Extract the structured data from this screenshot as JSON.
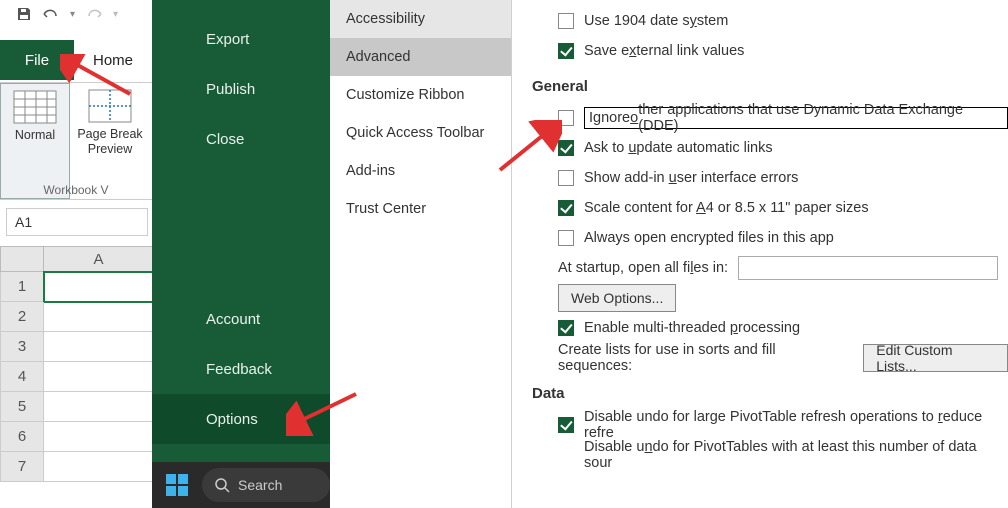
{
  "qat": {
    "save": "save-icon",
    "undo": "undo-icon",
    "redo": "redo-icon"
  },
  "tabs": {
    "file": "File",
    "home": "Home"
  },
  "ribbon": {
    "normal": "Normal",
    "pagebreak_line1": "Page Break",
    "pagebreak_line2": "Preview",
    "group_label": "Workbook V"
  },
  "namebox": "A1",
  "sheet": {
    "col": "A",
    "rows": [
      "1",
      "2",
      "3",
      "4",
      "5",
      "6",
      "7"
    ]
  },
  "backstage": {
    "items_top": [
      "Export",
      "Publish",
      "Close"
    ],
    "items_bottom": [
      "Account",
      "Feedback",
      "Options"
    ]
  },
  "taskbar": {
    "search": "Search"
  },
  "opt_categories": [
    {
      "label": "Accessibility",
      "state": "hover"
    },
    {
      "label": "Advanced",
      "state": "selected"
    },
    {
      "label": "Customize Ribbon",
      "state": ""
    },
    {
      "label": "Quick Access Toolbar",
      "state": ""
    },
    {
      "label": "Add-ins",
      "state": ""
    },
    {
      "label": "Trust Center",
      "state": ""
    }
  ],
  "advanced": {
    "use_1904": {
      "checked": false,
      "label_pre": "Use 1904 date s",
      "label_u": "y",
      "label_post": "stem"
    },
    "save_ext": {
      "checked": true,
      "label_pre": "Save e",
      "label_u": "x",
      "label_post": "ternal link values"
    },
    "section_general": "General",
    "ignore_dde": {
      "checked": false,
      "label_pre": "Ignore ",
      "label_u": "o",
      "label_post": "ther applications that use Dynamic Data Exchange (DDE)"
    },
    "ask_update": {
      "checked": true,
      "label_pre": "Ask to ",
      "label_u": "u",
      "label_post": "pdate automatic links"
    },
    "show_addin": {
      "checked": false,
      "label_pre": "Show add-in ",
      "label_u": "u",
      "label_post": "ser interface errors"
    },
    "scale_a4": {
      "checked": true,
      "label_pre": "Scale content for ",
      "label_u": "A",
      "label_post": "4 or 8.5 x 11\" paper sizes"
    },
    "always_open_enc": {
      "checked": false,
      "label": "Always open encrypted files in this app"
    },
    "startup_label_pre": "At startup, open all fi",
    "startup_label_u": "l",
    "startup_label_post": "es in:",
    "web_options": "Web Options...",
    "enable_multi": {
      "checked": true,
      "label_pre": "Enable multi-threaded ",
      "label_u": "p",
      "label_post": "rocessing"
    },
    "create_lists": "Create lists for use in sorts and fill sequences:",
    "edit_custom": "Edit Custom Lists...",
    "section_data": "Data",
    "disable_undo_pivot": {
      "checked": true,
      "label_pre": "Disable undo for large PivotTable refresh operations to ",
      "label_u": "r",
      "label_post": "educe refre"
    },
    "disable_undo_label_pre": "Disable u",
    "disable_undo_label_u": "n",
    "disable_undo_label_post": "do for PivotTables with at least this number of data sour"
  }
}
